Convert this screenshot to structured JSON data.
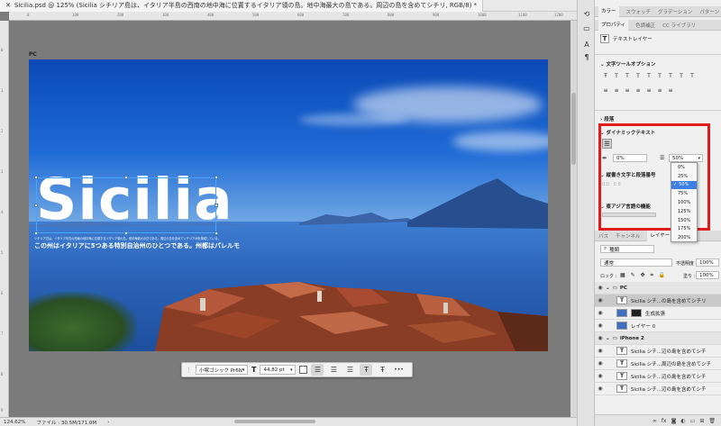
{
  "document": {
    "tab_title": "Sicilia.psd @ 125% (Sicilia シチリア島は、イタリア半島の西南の地中海に位置するイタリア領の島。地中海最大の島である。周辺の島を含めてシチリ, RGB/8) *",
    "artboard_label": "PC",
    "headline": "Sicilia",
    "caption_small": "シチリア島は、イタリア半島の西南の地中海に位置するイタリア領の島。地中海最大の島である。周辺の島を含めてシチリア州を構成している。",
    "subtitle": "この州はイタリアに5つある特別自治州のひとつである。州都はパレルモ"
  },
  "rulers": {
    "h_ticks": [
      "0",
      "100",
      "200",
      "300",
      "400",
      "500",
      "600",
      "700",
      "800",
      "900",
      "1000",
      "1100",
      "1200"
    ],
    "v_ticks": [
      "0",
      "1",
      "2",
      "3",
      "4",
      "5",
      "6",
      "7",
      "8",
      "9"
    ]
  },
  "text_toolbar": {
    "font": "小塚ゴシック Pr6N",
    "size": "44.82 pt",
    "more": "•••"
  },
  "status": {
    "zoom": "124.62%",
    "file_info": "ファイル : 30.5M/171.0M"
  },
  "panels": {
    "top_tabs": [
      "カラー",
      "スウォッチ",
      "グラデーション",
      "パターン"
    ],
    "props_tabs": [
      "プロパティ",
      "色調補正",
      "CC ライブラリ"
    ],
    "layer_type": "テキストレイヤー",
    "text_tool_options": "文字ツールオプション",
    "paragraph": "段落",
    "dynamic_text": "ダイナミックテキスト",
    "tracking_value": "0%",
    "leading_value": "50%",
    "dropdown_options": [
      "0%",
      "25%",
      "50%",
      "75%",
      "100%",
      "125%",
      "150%",
      "175%",
      "200%"
    ],
    "dropdown_selected": "50%",
    "vertical_section": "縦書き文字と段落番号",
    "east_asian": "東アジア言語の機能"
  },
  "layers": {
    "tabs": [
      "パス",
      "チャンネル",
      "レイヤー"
    ],
    "filter_label": "種類",
    "blend_mode": "通常",
    "opacity_label": "不透明度 :",
    "opacity_value": "100%",
    "lock_label": "ロック :",
    "fill_label": "塗り :",
    "fill_value": "100%",
    "rows": [
      {
        "name": "PC",
        "kind": "group"
      },
      {
        "name": "Sicilia シチ...の島を含めてシチリ",
        "kind": "text",
        "selected": true
      },
      {
        "name": "生成拡張",
        "kind": "image"
      },
      {
        "name": "レイヤー 0",
        "kind": "image"
      },
      {
        "name": "iPhone 2",
        "kind": "group"
      },
      {
        "name": "Sicilia シチ...辺の島を含めてシチ",
        "kind": "text"
      },
      {
        "name": "Sicilia シチ...周辺の島を含めてシチ",
        "kind": "text"
      },
      {
        "name": "Sicilia シチ...辺の島を含めてシチ",
        "kind": "text"
      },
      {
        "name": "Sicilia シチ...辺の島を含めてシチ",
        "kind": "text"
      }
    ]
  },
  "colors": {
    "accent_red": "#e21b1b",
    "selection_blue": "#3d7fe3"
  }
}
